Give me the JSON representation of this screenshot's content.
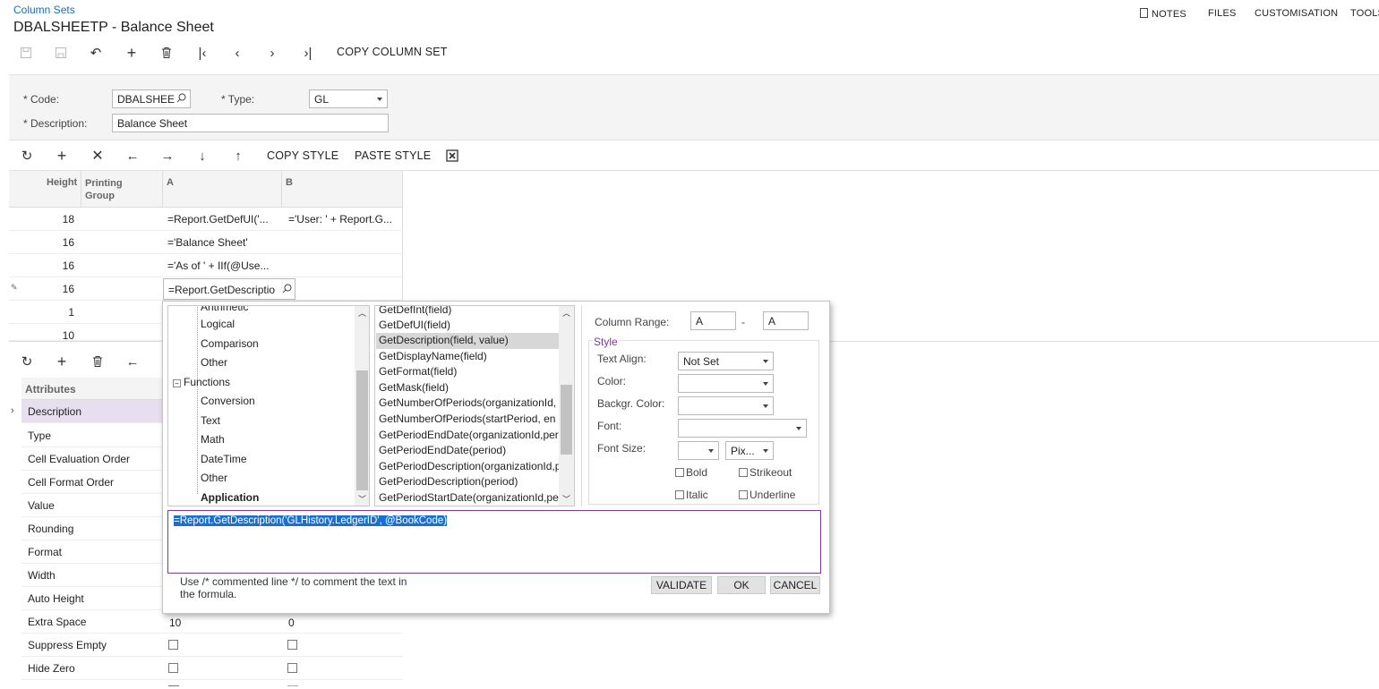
{
  "header": {
    "breadcrumb": "Column Sets",
    "title": "DBALSHEETP - Balance Sheet",
    "links": [
      "NOTES",
      "FILES",
      "CUSTOMISATION",
      "TOOLS"
    ],
    "copy_column_set": "COPY COLUMN SET"
  },
  "form": {
    "code_label": "* Code:",
    "code_value": "DBALSHEE",
    "type_label": "* Type:",
    "type_value": "GL",
    "description_label": "* Description:",
    "description_value": "Balance Sheet"
  },
  "grid_toolbar": {
    "copy_style": "COPY STYLE",
    "paste_style": "PASTE STYLE"
  },
  "grid": {
    "headers": [
      "Height",
      "Printing Group",
      "A",
      "B"
    ],
    "rows": [
      {
        "height": "18",
        "a": "=Report.GetDefUI('...",
        "b": "='User: ' + Report.G..."
      },
      {
        "height": "16",
        "a": "='Balance Sheet'",
        "b": ""
      },
      {
        "height": "16",
        "a": "='As of ' + IIf(@Use...",
        "b": ""
      },
      {
        "height": "16",
        "a": "=Report.GetDescriptio",
        "b": ""
      },
      {
        "height": "1",
        "a": "",
        "b": ""
      },
      {
        "height": "10",
        "a": "",
        "b": ""
      }
    ]
  },
  "attributes": {
    "header": "Attributes",
    "rows": [
      {
        "name": "Description",
        "a": "",
        "b": ""
      },
      {
        "name": "Type",
        "a": "",
        "b": ""
      },
      {
        "name": "Cell Evaluation Order",
        "a": "",
        "b": ""
      },
      {
        "name": "Cell Format Order",
        "a": "",
        "b": ""
      },
      {
        "name": "Value",
        "a": "",
        "b": ""
      },
      {
        "name": "Rounding",
        "a": "",
        "b": ""
      },
      {
        "name": "Format",
        "a": "",
        "b": ""
      },
      {
        "name": "Width",
        "a": "",
        "b": ""
      },
      {
        "name": "Auto Height",
        "a": "",
        "b": ""
      },
      {
        "name": "Extra Space",
        "a": "10",
        "b": "0"
      },
      {
        "name": "Suppress Empty",
        "a": "",
        "b": ""
      },
      {
        "name": "Hide Zero",
        "a": "",
        "b": ""
      }
    ]
  },
  "dialog": {
    "tree": [
      "Arithmetic",
      "Logical",
      "Comparison",
      "Other",
      "Functions",
      "Conversion",
      "Text",
      "Math",
      "DateTime",
      "Other",
      "Application"
    ],
    "functions": [
      "GetDefInt(field)",
      "GetDefUI(field)",
      "GetDescription(field, value)",
      "GetDisplayName(field)",
      "GetFormat(field)",
      "GetMask(field)",
      "GetNumberOfPeriods(organizationId,",
      "GetNumberOfPeriods(startPeriod, en",
      "GetPeriodEndDate(organizationId,per",
      "GetPeriodEndDate(period)",
      "GetPeriodDescription(organizationId,p",
      "GetPeriodDescription(period)",
      "GetPeriodStartDate(organizationId,pe"
    ],
    "column_range_label": "Column Range:",
    "range_from": "A",
    "range_sep": "-",
    "range_to": "A",
    "style_legend": "Style",
    "text_align_label": "Text Align:",
    "text_align_value": "Not Set",
    "color_label": "Color:",
    "backgr_color_label": "Backgr. Color:",
    "font_label": "Font:",
    "font_size_label": "Font Size:",
    "font_unit": "Pix...",
    "bold": "Bold",
    "strikeout": "Strikeout",
    "italic": "Italic",
    "underline": "Underline",
    "formula": "=Report.GetDescription('GLHistory.LedgerID', @BookCode)",
    "hint": "Use /* commented line */ to comment the text in the formula.",
    "validate": "VALIDATE",
    "ok": "OK",
    "cancel": "CANCEL"
  }
}
